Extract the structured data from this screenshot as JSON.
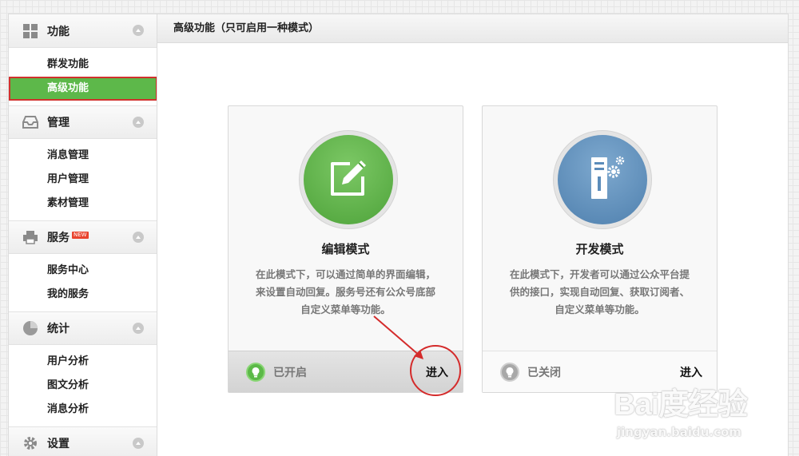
{
  "sidebar": {
    "sections": [
      {
        "title": "功能",
        "icon": "grid-icon",
        "items": [
          "群发功能",
          "高级功能"
        ],
        "active_index": 1
      },
      {
        "title": "管理",
        "icon": "inbox-icon",
        "items": [
          "消息管理",
          "用户管理",
          "素材管理"
        ]
      },
      {
        "title": "服务",
        "icon": "printer-icon",
        "badge": "NEW",
        "items": [
          "服务中心",
          "我的服务"
        ]
      },
      {
        "title": "统计",
        "icon": "pie-chart-icon",
        "items": [
          "用户分析",
          "图文分析",
          "消息分析"
        ]
      },
      {
        "title": "设置",
        "icon": "gear-icon",
        "items": []
      }
    ]
  },
  "main": {
    "title": "高级功能（只可启用一种模式）",
    "cards": [
      {
        "title": "编辑模式",
        "icon": "edit-icon",
        "description_lines": [
          "在此模式下，可以通过简单的界面编辑，",
          "来设置自动回复。服务号还有公众号底部",
          "自定义菜单等功能。"
        ],
        "status": "已开启",
        "action": "进入",
        "color": "#5cb948"
      },
      {
        "title": "开发模式",
        "icon": "server-gear-icon",
        "description_lines": [
          "在此模式下，开发者可以通过公众平台提",
          "供的接口，实现自动回复、获取订阅者、",
          "自定义菜单等功能。"
        ],
        "status": "已关闭",
        "action": "进入",
        "color": "#5b8cba"
      }
    ]
  },
  "watermark": {
    "logo": "Bai度经验",
    "url": "jingyan.baidu.com"
  },
  "colors": {
    "active_green": "#5db84a",
    "highlight_red": "#d42b2b"
  }
}
